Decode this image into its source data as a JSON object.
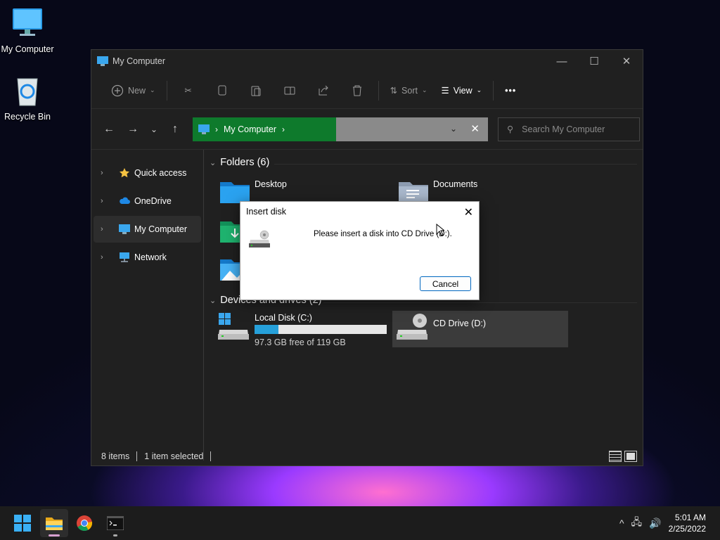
{
  "desktop": {
    "icons": [
      {
        "label": "My Computer",
        "icon": "monitor-icon"
      },
      {
        "label": "Recycle Bin",
        "icon": "recycle-bin-icon"
      }
    ]
  },
  "window": {
    "title": "My Computer",
    "toolbar": {
      "new_label": "New",
      "sort_label": "Sort",
      "view_label": "View",
      "more_label": "•••"
    },
    "address": {
      "crumb": "My Computer",
      "search_placeholder": "Search My Computer"
    },
    "sidebar": [
      {
        "label": "Quick access",
        "icon": "star-icon"
      },
      {
        "label": "OneDrive",
        "icon": "cloud-icon"
      },
      {
        "label": "My Computer",
        "icon": "monitor-icon",
        "active": true
      },
      {
        "label": "Network",
        "icon": "network-icon"
      }
    ],
    "folders_header": "Folders (6)",
    "folders": [
      {
        "label": "Desktop"
      },
      {
        "label": "Documents"
      }
    ],
    "devices_header": "Devices and drives (2)",
    "drives": [
      {
        "label": "Local Disk (C:)",
        "free_text": "97.3 GB free of 119 GB",
        "used_fraction": 0.18
      },
      {
        "label": "CD Drive (D:)"
      }
    ],
    "status": {
      "items": "8 items",
      "selected": "1 item selected"
    }
  },
  "dialog": {
    "title": "Insert disk",
    "message": "Please insert a disk into CD Drive (D:).",
    "cancel_label": "Cancel"
  },
  "taskbar": {
    "time": "5:01 AM",
    "date": "2/25/2022"
  },
  "colors": {
    "accent": "#0e7a2c",
    "progress": "#26a0da"
  }
}
